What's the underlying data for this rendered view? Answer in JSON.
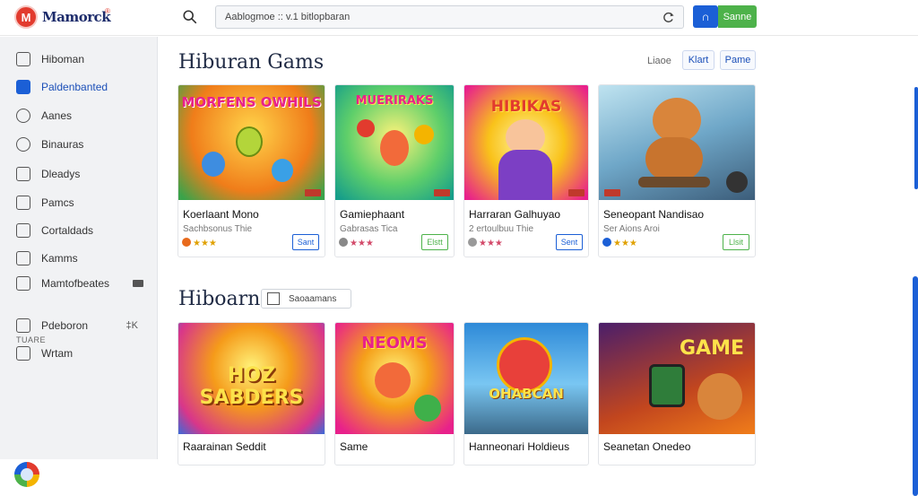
{
  "header": {
    "logo_glyph": "M",
    "brand": "Mamorck",
    "brand_sup": "®",
    "search_value": "Aablogmoe :: v.1 bitlopbaran",
    "btn_primary": "∩",
    "btn_secondary": "Sanne"
  },
  "sidebar": {
    "items": [
      {
        "label": "Hiboman",
        "icon": "list-icon"
      },
      {
        "label": "Paldenbanted",
        "icon": "grid-icon"
      },
      {
        "label": "Aanes",
        "icon": "circle-icon"
      },
      {
        "label": "Binauras",
        "icon": "circle-icon"
      },
      {
        "label": "Dleadys",
        "icon": "bookmark-icon"
      },
      {
        "label": "Pamcs",
        "icon": "folder-icon"
      },
      {
        "label": "Cortaldads",
        "icon": "page-icon"
      },
      {
        "label": "Kamms",
        "icon": "home-icon"
      },
      {
        "label": "Mamtofbeates",
        "icon": "tag-icon"
      }
    ],
    "section_label": "TUARE",
    "bottom_items": [
      {
        "label": "Pdeboron",
        "icon": "page-icon",
        "trail": "‡K"
      },
      {
        "label": "Wrtam",
        "icon": "page-icon"
      }
    ]
  },
  "main": {
    "section1": {
      "title": "Hiburan Gams",
      "sort_label": "Liaoe",
      "pill_a": "Klart",
      "pill_b": "Pame"
    },
    "section2": {
      "title": "Hiboarn",
      "chip_label": "Saoaamans"
    },
    "cards1": [
      {
        "art": "MORFENS OWHILS",
        "title": "Koerlaant Mono",
        "sub": "Sachbsonus Thie",
        "action": "Sant",
        "action_color": "#1b5fd6"
      },
      {
        "art": "MUERIRAKS",
        "title": "Gamiephaant",
        "sub": "Gabrasas Tica",
        "action": "Elstt",
        "action_color": "#4db24a"
      },
      {
        "art": "HIBIKAS",
        "title": "Harraran Galhuyao",
        "sub": "2 ertoulbuu Thie",
        "action": "Sent",
        "action_color": "#1b5fd6"
      },
      {
        "art": "",
        "title": "Seneopant Nandisao",
        "sub": "Ser Aions Aroi",
        "action": "Llsit",
        "action_color": "#4db24a"
      }
    ],
    "cards2": [
      {
        "art": "HOZ SABDERS",
        "title": "Raarainan Seddit"
      },
      {
        "art": "NEOMS",
        "title": "Same"
      },
      {
        "art": "OHABCAN",
        "title": "Hanneonari Holdieus"
      },
      {
        "art": "GAME",
        "title": "Seanetan Onedeo"
      }
    ]
  }
}
